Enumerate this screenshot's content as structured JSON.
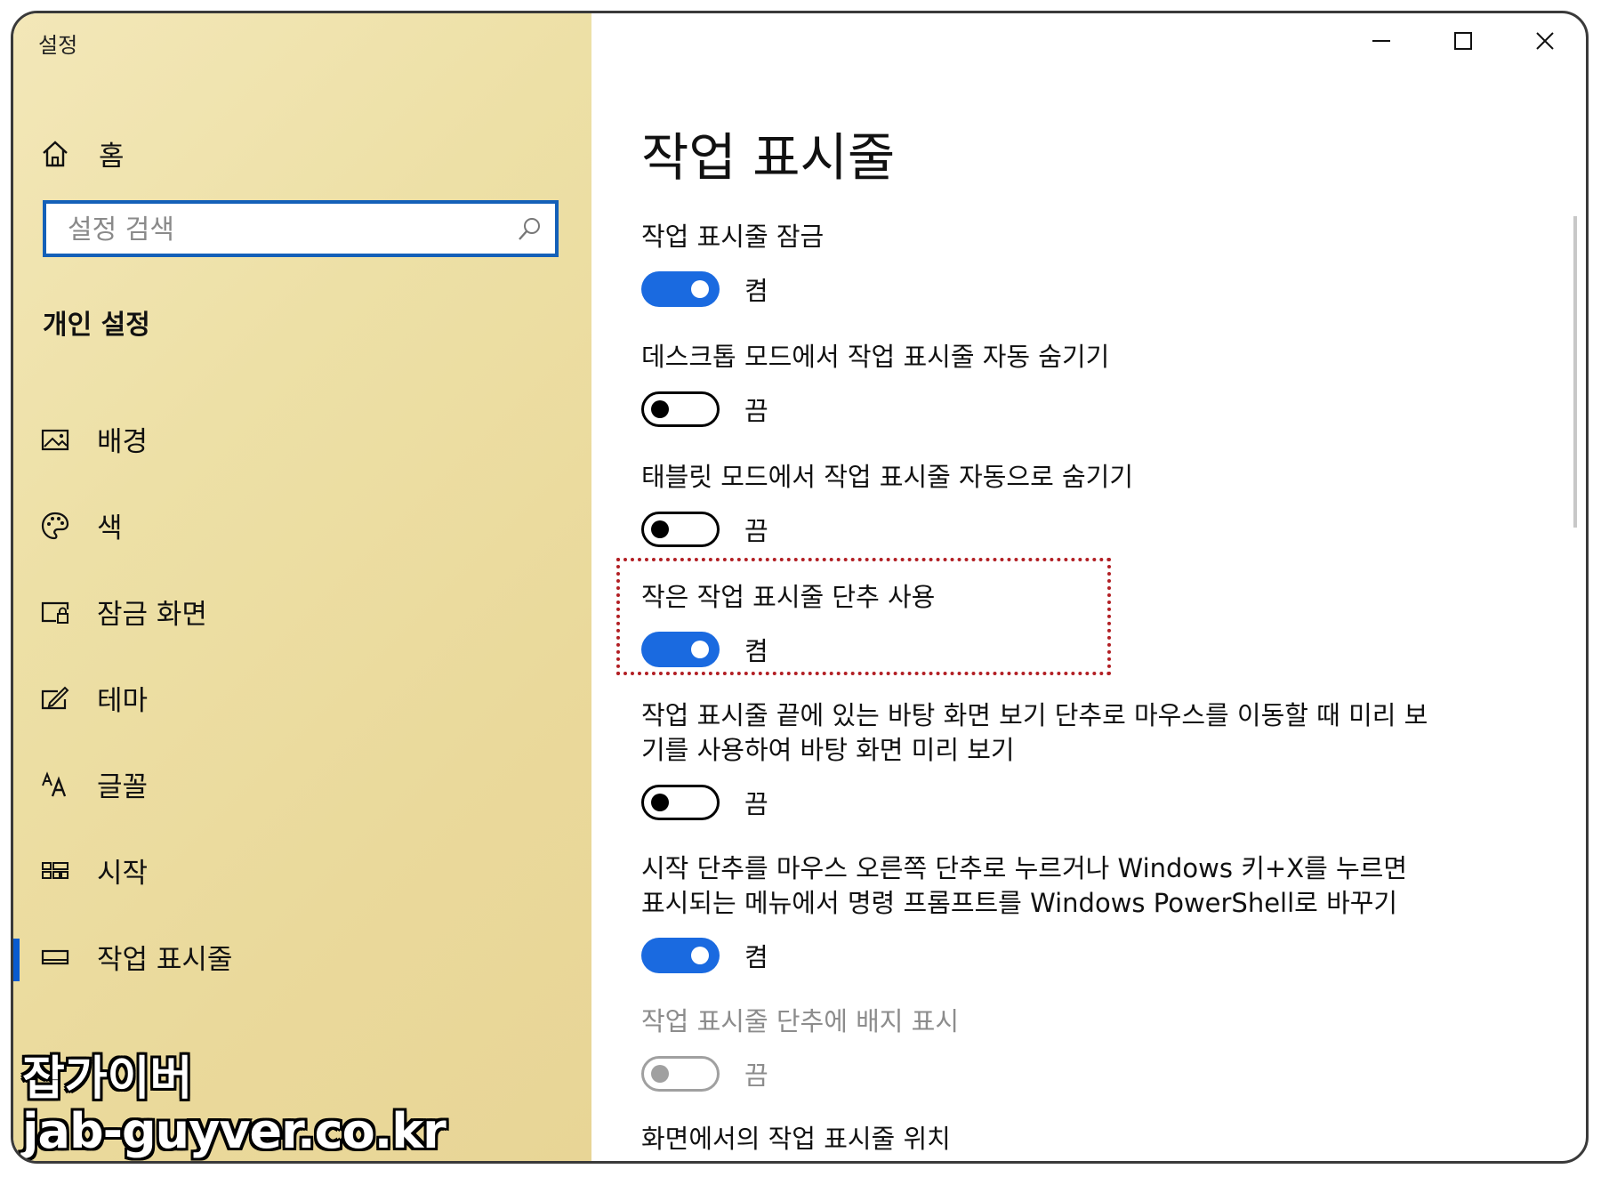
{
  "window": {
    "title": "설정"
  },
  "sidebar": {
    "home_label": "홈",
    "search_placeholder": "설정 검색",
    "section_title": "개인 설정",
    "items": [
      {
        "label": "배경",
        "icon": "picture-icon"
      },
      {
        "label": "색",
        "icon": "palette-icon"
      },
      {
        "label": "잠금 화면",
        "icon": "lock-screen-icon"
      },
      {
        "label": "테마",
        "icon": "theme-icon"
      },
      {
        "label": "글꼴",
        "icon": "font-icon"
      },
      {
        "label": "시작",
        "icon": "start-icon"
      },
      {
        "label": "작업 표시줄",
        "icon": "taskbar-icon",
        "active": true
      }
    ]
  },
  "main": {
    "title": "작업 표시줄",
    "settings": [
      {
        "label": "작업 표시줄 잠금",
        "state": "켬",
        "on": true
      },
      {
        "label": "데스크톱 모드에서 작업 표시줄 자동 숨기기",
        "state": "끔",
        "on": false
      },
      {
        "label": "태블릿 모드에서 작업 표시줄 자동으로 숨기기",
        "state": "끔",
        "on": false
      },
      {
        "label": "작은 작업 표시줄 단추 사용",
        "state": "켬",
        "on": true,
        "highlighted": true
      },
      {
        "label": "작업 표시줄 끝에 있는 바탕 화면 보기 단추로 마우스를 이동할 때 미리 보기를 사용하여 바탕 화면 미리 보기",
        "state": "끔",
        "on": false
      },
      {
        "label": "시작 단추를 마우스 오른쪽 단추로 누르거나 Windows 키+X를 누르면 표시되는 메뉴에서 명령 프롬프트를 Windows PowerShell로 바꾸기",
        "state": "켬",
        "on": true
      },
      {
        "label": "작업 표시줄 단추에 배지 표시",
        "state": "끔",
        "on": false,
        "disabled": true
      }
    ],
    "position_label": "화면에서의 작업 표시줄 위치"
  },
  "watermark": {
    "line1": "잡가이버",
    "line2": "jab-guyver.co.kr"
  },
  "colors": {
    "accent": "#1a6ae0",
    "highlight_border": "#b21f24",
    "sidebar_bg": "#ede0a6"
  }
}
